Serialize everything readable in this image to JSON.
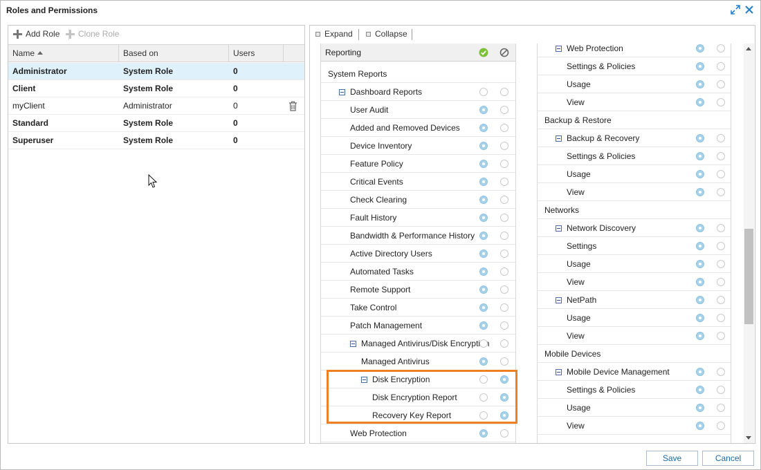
{
  "window": {
    "title": "Roles and Permissions"
  },
  "roles_toolbar": {
    "add_role": "Add Role",
    "clone_role": "Clone Role"
  },
  "roles_grid": {
    "columns": [
      "Name",
      "Based on",
      "Users"
    ],
    "rows": [
      {
        "name": "Administrator",
        "based_on": "System Role",
        "users": "0"
      },
      {
        "name": "Client",
        "based_on": "System Role",
        "users": "0"
      },
      {
        "name": "myClient",
        "based_on": "Administrator",
        "users": "0"
      },
      {
        "name": "Standard",
        "based_on": "System Role",
        "users": "0"
      },
      {
        "name": "Superuser",
        "based_on": "System Role",
        "users": "0"
      }
    ]
  },
  "permissions_toolbar": {
    "expand": "Expand",
    "collapse": "Collapse"
  },
  "permissions_left": {
    "header": "Reporting",
    "items": [
      {
        "label": "System Reports",
        "type": "section"
      },
      {
        "label": "Dashboard Reports",
        "state": "none"
      },
      {
        "label": "User Audit",
        "state": "allow"
      },
      {
        "label": "Added and Removed Devices",
        "state": "allow"
      },
      {
        "label": "Device Inventory",
        "state": "allow"
      },
      {
        "label": "Feature Policy",
        "state": "allow"
      },
      {
        "label": "Critical Events",
        "state": "allow"
      },
      {
        "label": "Check Clearing",
        "state": "allow"
      },
      {
        "label": "Fault History",
        "state": "allow"
      },
      {
        "label": "Bandwidth & Performance History",
        "state": "allow"
      },
      {
        "label": "Active Directory Users",
        "state": "allow"
      },
      {
        "label": "Automated Tasks",
        "state": "allow"
      },
      {
        "label": "Remote Support",
        "state": "allow"
      },
      {
        "label": "Take Control",
        "state": "allow"
      },
      {
        "label": "Patch Management",
        "state": "allow"
      },
      {
        "label": "Managed Antivirus/Disk Encryption",
        "state": "none"
      },
      {
        "label": "Managed Antivirus",
        "state": "allow"
      },
      {
        "label": "Disk Encryption",
        "state": "deny"
      },
      {
        "label": "Disk Encryption Report",
        "state": "deny"
      },
      {
        "label": "Recovery Key Report",
        "state": "deny"
      },
      {
        "label": "Web Protection",
        "state": "allow"
      }
    ]
  },
  "permissions_right": {
    "items": [
      {
        "label": "Web Protection",
        "state": "allow"
      },
      {
        "label": "Settings & Policies",
        "state": "allow"
      },
      {
        "label": "Usage",
        "state": "allow"
      },
      {
        "label": "View",
        "state": "allow"
      },
      {
        "label": "Backup & Restore",
        "type": "section"
      },
      {
        "label": "Backup & Recovery",
        "state": "allow"
      },
      {
        "label": "Settings & Policies",
        "state": "allow"
      },
      {
        "label": "Usage",
        "state": "allow"
      },
      {
        "label": "View",
        "state": "allow"
      },
      {
        "label": "Networks",
        "type": "section"
      },
      {
        "label": "Network Discovery",
        "state": "allow"
      },
      {
        "label": "Settings",
        "state": "allow"
      },
      {
        "label": "Usage",
        "state": "allow"
      },
      {
        "label": "View",
        "state": "allow"
      },
      {
        "label": "NetPath",
        "state": "allow"
      },
      {
        "label": "Usage",
        "state": "allow"
      },
      {
        "label": "View",
        "state": "allow"
      },
      {
        "label": "Mobile Devices",
        "type": "section"
      },
      {
        "label": "Mobile Device Management",
        "state": "allow"
      },
      {
        "label": "Settings & Policies",
        "state": "allow"
      },
      {
        "label": "Usage",
        "state": "allow"
      },
      {
        "label": "View",
        "state": "allow"
      }
    ]
  },
  "footer": {
    "save": "Save",
    "cancel": "Cancel"
  },
  "colors": {
    "accent": "#1a6aa8",
    "highlight": "#f07f20",
    "selected_row": "#dff1fa",
    "allow_icon": "#7cc13a"
  }
}
